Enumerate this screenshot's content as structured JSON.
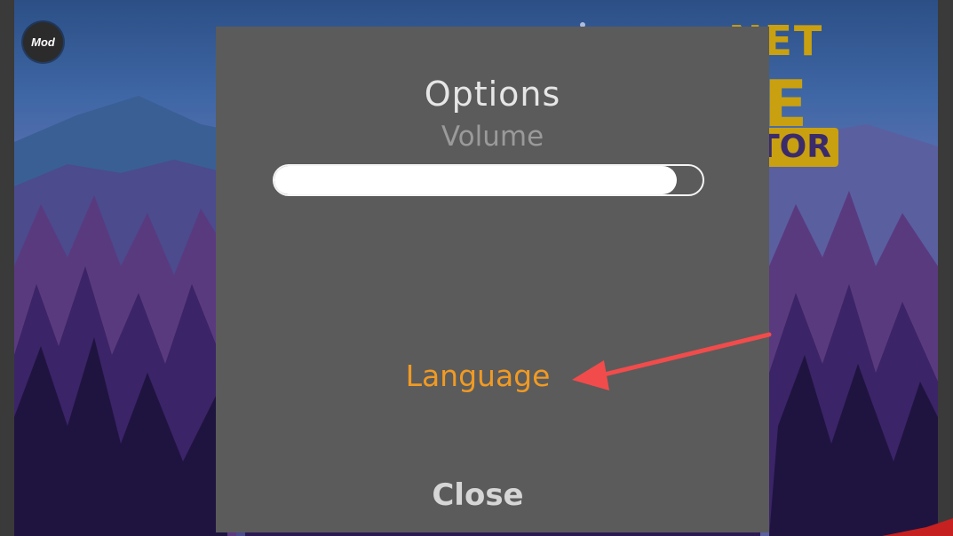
{
  "mod_badge": {
    "label": "Mod"
  },
  "game_logo": {
    "line1": "NET",
    "line2": "E",
    "line3": "ATOR"
  },
  "options_dialog": {
    "title": "Options",
    "volume_label": "Volume",
    "volume_level": 0.94,
    "language_label": "Language",
    "close_label": "Close"
  },
  "colors": {
    "dialog_bg": "#5b5b5b",
    "language_accent": "#f09a24",
    "logo_gold": "#c9a010",
    "annotation_red": "#f24b4b"
  }
}
